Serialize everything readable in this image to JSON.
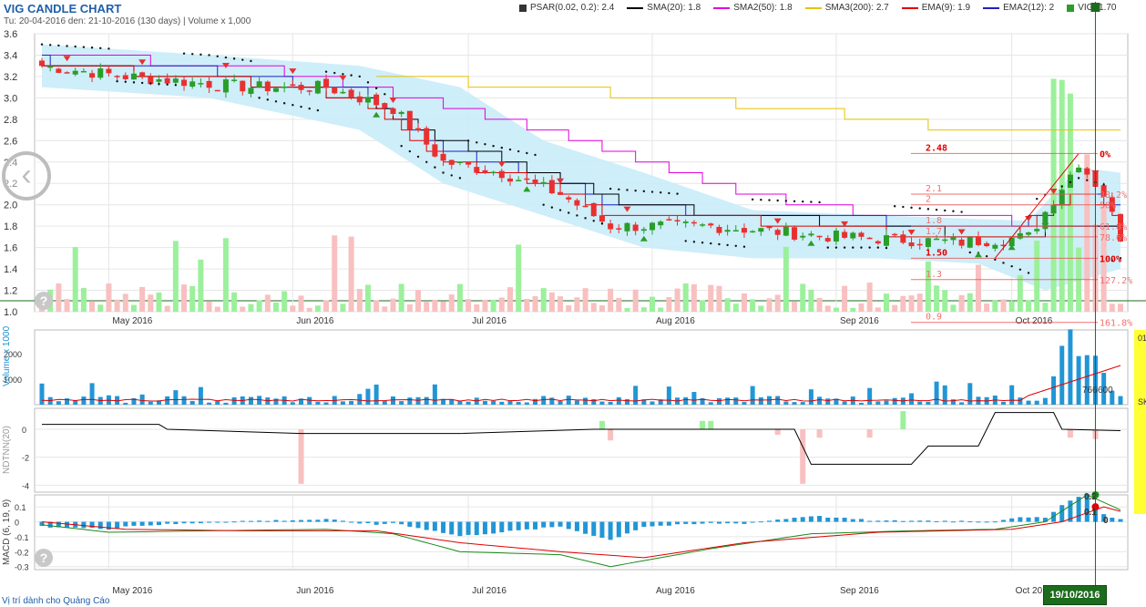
{
  "header": {
    "title": "VIG CANDLE CHART",
    "subtitle": "Tu: 20-04-2016 den: 21-10-2016 (130 days) | Volume x 1,000"
  },
  "legend": [
    {
      "label": "PSAR(0.02, 0.2): 2.4",
      "color": "#333333",
      "kind": "box"
    },
    {
      "label": "SMA(20): 1.8",
      "color": "#000000",
      "kind": "line"
    },
    {
      "label": "SMA2(50): 1.8",
      "color": "#e000e0",
      "kind": "line"
    },
    {
      "label": "SMA3(200): 2.7",
      "color": "#e6c200",
      "kind": "line"
    },
    {
      "label": "EMA(9): 1.9",
      "color": "#e00000",
      "kind": "line"
    },
    {
      "label": "EMA2(12): 2",
      "color": "#2020c0",
      "kind": "line"
    },
    {
      "label": "VIG: 1.70",
      "color": "#2a9d2a",
      "kind": "box"
    }
  ],
  "footer": {
    "ad_link": "Vị trí dành cho Quảng Cáo"
  },
  "cursor": {
    "date_label": "19/10/2016"
  },
  "side_panel": {
    "text_top": "01",
    "text_mid": "SK"
  },
  "colors": {
    "up": "#2a9d2a",
    "down": "#e83030",
    "bb": "#c9ecf8",
    "vol_up": "#9cf09c",
    "vol_down": "#f8c0c0",
    "vol_bar": "#2196d6",
    "grid": "#e6e6e6"
  },
  "icons": {
    "prev": "chevron-left-icon",
    "help": "question-mark-icon"
  },
  "chart_data": [
    {
      "type": "candlestick",
      "panel": "price",
      "x_ticks": [
        "May 2016",
        "Jun 2016",
        "Jul 2016",
        "Aug 2016",
        "Sep 2016",
        "Oct 2016"
      ],
      "ylim": [
        1.0,
        3.6
      ],
      "y_ticks": [
        "1.0",
        "1.2",
        "1.4",
        "1.6",
        "1.8",
        "2.0",
        "2.2",
        "2.4",
        "2.6",
        "2.8",
        "3.0",
        "3.2",
        "3.4",
        "3.6"
      ],
      "close_anchors": [
        [
          0,
          3.3
        ],
        [
          10,
          3.2
        ],
        [
          25,
          3.1
        ],
        [
          34,
          3.1
        ],
        [
          42,
          2.9
        ],
        [
          48,
          2.4
        ],
        [
          55,
          2.3
        ],
        [
          62,
          2.1
        ],
        [
          68,
          1.8
        ],
        [
          80,
          1.8
        ],
        [
          95,
          1.7
        ],
        [
          110,
          1.65
        ],
        [
          118,
          1.7
        ],
        [
          124,
          2.4
        ],
        [
          127,
          2.1
        ],
        [
          129,
          1.7
        ]
      ],
      "sma20_anchors": [
        [
          0,
          3.3
        ],
        [
          20,
          3.2
        ],
        [
          38,
          3.0
        ],
        [
          48,
          2.6
        ],
        [
          60,
          2.3
        ],
        [
          70,
          2.0
        ],
        [
          85,
          1.9
        ],
        [
          100,
          1.8
        ],
        [
          115,
          1.7
        ],
        [
          124,
          1.8
        ],
        [
          129,
          1.8
        ]
      ],
      "sma50_anchors": [
        [
          0,
          3.4
        ],
        [
          25,
          3.3
        ],
        [
          45,
          3.0
        ],
        [
          60,
          2.7
        ],
        [
          72,
          2.4
        ],
        [
          85,
          2.1
        ],
        [
          100,
          1.9
        ],
        [
          115,
          1.85
        ],
        [
          129,
          1.8
        ]
      ],
      "sma200_anchors": [
        [
          40,
          3.2
        ],
        [
          60,
          3.1
        ],
        [
          75,
          3.0
        ],
        [
          90,
          2.9
        ],
        [
          110,
          2.7
        ],
        [
          129,
          2.7
        ]
      ],
      "ema9_anchors": [
        [
          0,
          3.3
        ],
        [
          20,
          3.2
        ],
        [
          38,
          3.0
        ],
        [
          48,
          2.4
        ],
        [
          60,
          2.2
        ],
        [
          68,
          1.9
        ],
        [
          85,
          1.85
        ],
        [
          100,
          1.75
        ],
        [
          115,
          1.7
        ],
        [
          124,
          2.1
        ],
        [
          129,
          1.9
        ]
      ],
      "ema12_anchors": [
        [
          0,
          3.35
        ],
        [
          20,
          3.25
        ],
        [
          38,
          3.05
        ],
        [
          48,
          2.5
        ],
        [
          60,
          2.3
        ],
        [
          68,
          2.0
        ],
        [
          85,
          1.9
        ],
        [
          100,
          1.85
        ],
        [
          115,
          1.75
        ],
        [
          124,
          2.1
        ],
        [
          129,
          2.0
        ]
      ],
      "bb_upper_anchors": [
        [
          0,
          3.5
        ],
        [
          20,
          3.4
        ],
        [
          38,
          3.3
        ],
        [
          50,
          3.1
        ],
        [
          60,
          2.6
        ],
        [
          72,
          2.3
        ],
        [
          85,
          1.95
        ],
        [
          100,
          1.9
        ],
        [
          118,
          1.85
        ],
        [
          124,
          2.35
        ],
        [
          129,
          2.3
        ]
      ],
      "bb_lower_anchors": [
        [
          0,
          3.1
        ],
        [
          20,
          3.0
        ],
        [
          38,
          2.7
        ],
        [
          48,
          2.2
        ],
        [
          60,
          1.9
        ],
        [
          72,
          1.6
        ],
        [
          85,
          1.5
        ],
        [
          100,
          1.5
        ],
        [
          112,
          1.45
        ],
        [
          120,
          1.2
        ],
        [
          129,
          1.4
        ]
      ],
      "fib_levels": [
        {
          "label": "0%",
          "value": 2.48,
          "value_label": "2.48"
        },
        {
          "label": "38.2%",
          "value": 2.1,
          "value_label": "2.1"
        },
        {
          "label": "50%",
          "value": 2.0,
          "value_label": "2"
        },
        {
          "label": "61.8%",
          "value": 1.8,
          "value_label": "1.8"
        },
        {
          "label": "78.6%",
          "value": 1.7,
          "value_label": "1.7"
        },
        {
          "label": "100%",
          "value": 1.5,
          "value_label": "1.50"
        },
        {
          "label": "127.2%",
          "value": 1.3,
          "value_label": "1.3"
        },
        {
          "label": "161.8%",
          "value": 0.9,
          "value_label": "0.9"
        }
      ],
      "last_close": 1.7
    },
    {
      "type": "bar",
      "panel": "volume",
      "ylabel": "Volume x 1000",
      "y_ticks": [
        "1000",
        "2000"
      ],
      "value_labels": [
        "766",
        "600"
      ]
    },
    {
      "type": "bar",
      "panel": "ndtnn",
      "ylabel": "NDTNN(20)",
      "y_ticks": [
        "0",
        "-2",
        "-4"
      ],
      "ylim": [
        -4.5,
        1.5
      ]
    },
    {
      "type": "line",
      "panel": "macd",
      "ylabel": "MACD (6, 19, 9)",
      "y_ticks": [
        "0.1",
        "0",
        "-0.1",
        "-0.2",
        "-0.3"
      ],
      "ylim": [
        -0.32,
        0.18
      ],
      "value_labels": [
        "0.2",
        "0.1",
        "0"
      ]
    }
  ]
}
